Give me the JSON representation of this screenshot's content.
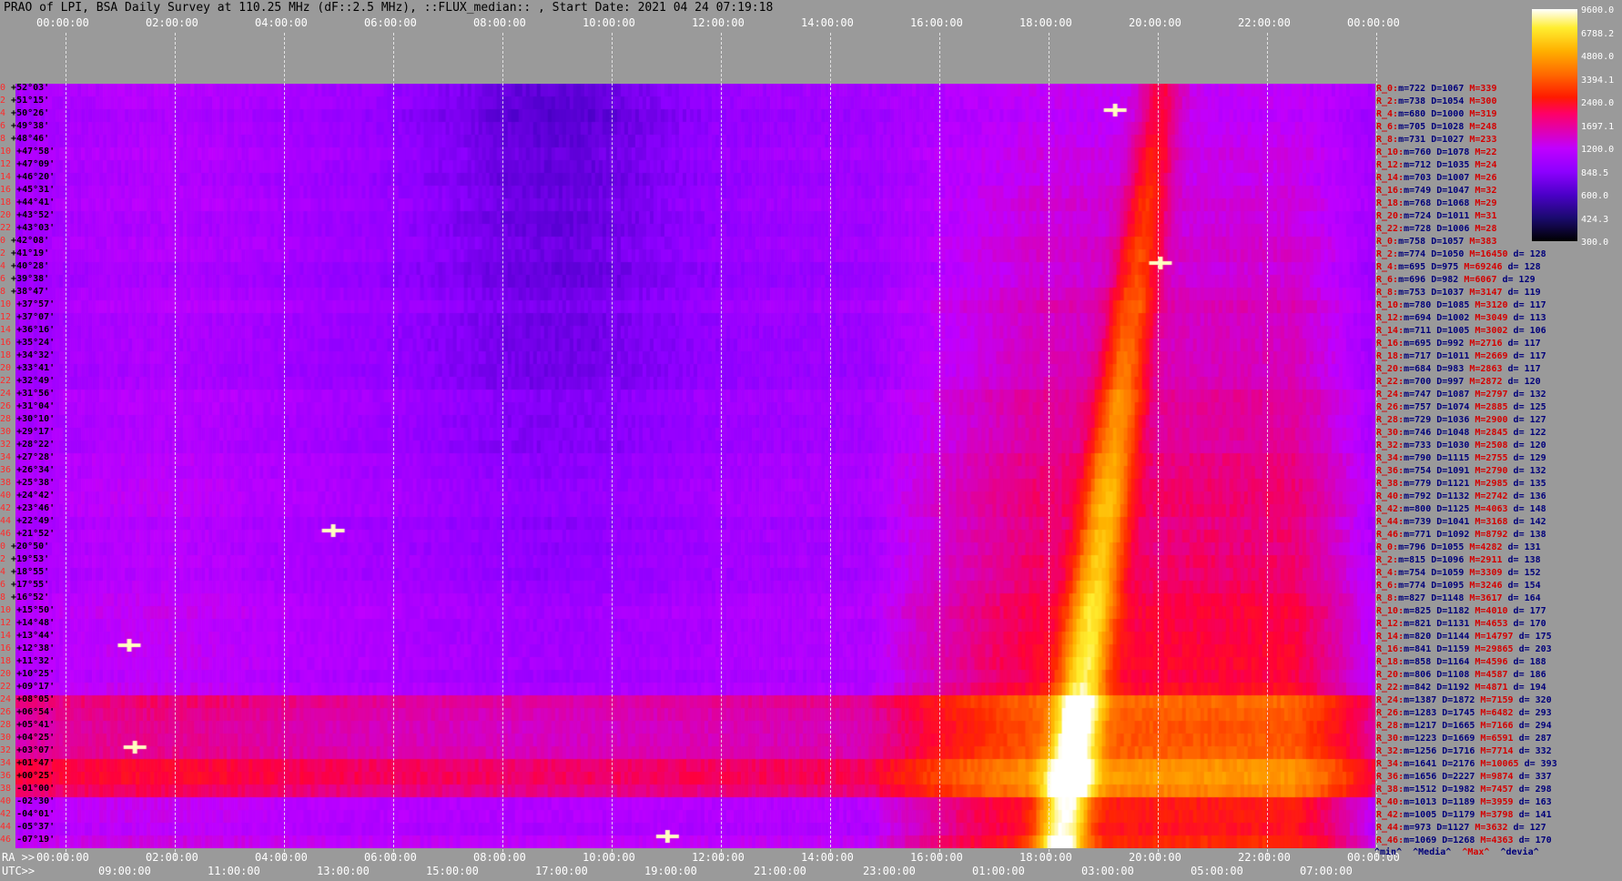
{
  "title": "PRAO of LPI, BSA Daily Survey at 110.25 MHz (dF::2.5 MHz), ::FLUX_median:: , Start Date: 2021 04 24 07:19:18",
  "axes": {
    "top_ticks": [
      "00:00:00",
      "02:00:00",
      "04:00:00",
      "06:00:00",
      "08:00:00",
      "10:00:00",
      "12:00:00",
      "14:00:00",
      "16:00:00",
      "18:00:00",
      "20:00:00",
      "22:00:00",
      "00:00:00"
    ],
    "bottom_ra_label": "RA >>",
    "bottom_ra_ticks": [
      "00:00:00",
      "02:00:00",
      "04:00:00",
      "06:00:00",
      "08:00:00",
      "10:00:00",
      "12:00:00",
      "14:00:00",
      "16:00:00",
      "18:00:00",
      "20:00:00",
      "22:00:00",
      "00:00:00"
    ],
    "utc_label": "UTC>>",
    "utc_ticks": [
      "09:00:00",
      "11:00:00",
      "13:00:00",
      "15:00:00",
      "17:00:00",
      "19:00:00",
      "21:00:00",
      "23:00:00",
      "01:00:00",
      "03:00:00",
      "05:00:00",
      "07:00:00"
    ]
  },
  "colorbar": {
    "labels": [
      "9600.0",
      "6788.2",
      "4800.0",
      "3394.1",
      "2400.0",
      "1697.1",
      "1200.0",
      "848.5",
      "600.0",
      "424.3",
      "300.0"
    ]
  },
  "legend": [
    "^min^",
    "^Media^",
    "^Max^",
    "^devia^"
  ],
  "colors": {
    "background": "#9a9a9a",
    "min_color": "#00007a",
    "max_color": "#d40000"
  },
  "chart_data": {
    "type": "heatmap",
    "title": "PRAO of LPI, BSA Daily Survey at 110.25 MHz (dF::2.5 MHz), ::FLUX_median:: , Start Date: 2021 04 24 07:19:18",
    "x_range_hours": [
      0,
      24
    ],
    "color_scale": "log",
    "color_range": [
      300,
      9600
    ],
    "rows": [
      {
        "idx": "0",
        "dec": "+52°03'",
        "min": "722",
        "median": "1067",
        "max": "339",
        "dev": ""
      },
      {
        "idx": "2",
        "dec": "+51°15'",
        "min": "738",
        "median": "1054",
        "max": "300",
        "dev": ""
      },
      {
        "idx": "4",
        "dec": "+50°26'",
        "min": "680",
        "median": "1000",
        "max": "319",
        "dev": ""
      },
      {
        "idx": "6",
        "dec": "+49°38'",
        "min": "705",
        "median": "1028",
        "max": "248",
        "dev": ""
      },
      {
        "idx": "8",
        "dec": "+48°46'",
        "min": "731",
        "median": "1027",
        "max": "233",
        "dev": ""
      },
      {
        "idx": "10",
        "dec": "+47°58'",
        "min": "760",
        "median": "1078",
        "max": "22",
        "dev": ""
      },
      {
        "idx": "12",
        "dec": "+47°09'",
        "min": "712",
        "median": "1035",
        "max": "24",
        "dev": ""
      },
      {
        "idx": "14",
        "dec": "+46°20'",
        "min": "703",
        "median": "1007",
        "max": "26",
        "dev": ""
      },
      {
        "idx": "16",
        "dec": "+45°31'",
        "min": "749",
        "median": "1047",
        "max": "32",
        "dev": ""
      },
      {
        "idx": "18",
        "dec": "+44°41'",
        "min": "768",
        "median": "1068",
        "max": "29",
        "dev": ""
      },
      {
        "idx": "20",
        "dec": "+43°52'",
        "min": "724",
        "median": "1011",
        "max": "31",
        "dev": ""
      },
      {
        "idx": "22",
        "dec": "+43°03'",
        "min": "728",
        "median": "1006",
        "max": "28",
        "dev": ""
      },
      {
        "idx": "0",
        "dec": "+42°08'",
        "min": "758",
        "median": "1057",
        "max": "383",
        "dev": ""
      },
      {
        "idx": "2",
        "dec": "+41°19'",
        "min": "774",
        "median": "1050",
        "max": "16450",
        "dev": "128"
      },
      {
        "idx": "4",
        "dec": "+40°28'",
        "min": "695",
        "median": "975",
        "max": "69246",
        "dev": "128"
      },
      {
        "idx": "6",
        "dec": "+39°38'",
        "min": "696",
        "median": "982",
        "max": "6067",
        "dev": "129"
      },
      {
        "idx": "8",
        "dec": "+38°47'",
        "min": "753",
        "median": "1037",
        "max": "3147",
        "dev": "119"
      },
      {
        "idx": "10",
        "dec": "+37°57'",
        "min": "780",
        "median": "1085",
        "max": "3120",
        "dev": "117"
      },
      {
        "idx": "12",
        "dec": "+37°07'",
        "min": "694",
        "median": "1002",
        "max": "3049",
        "dev": "113"
      },
      {
        "idx": "14",
        "dec": "+36°16'",
        "min": "711",
        "median": "1005",
        "max": "3002",
        "dev": "106"
      },
      {
        "idx": "16",
        "dec": "+35°24'",
        "min": "695",
        "median": "992",
        "max": "2716",
        "dev": "117"
      },
      {
        "idx": "18",
        "dec": "+34°32'",
        "min": "717",
        "median": "1011",
        "max": "2669",
        "dev": "117"
      },
      {
        "idx": "20",
        "dec": "+33°41'",
        "min": "684",
        "median": "983",
        "max": "2863",
        "dev": "117"
      },
      {
        "idx": "22",
        "dec": "+32°49'",
        "min": "700",
        "median": "997",
        "max": "2872",
        "dev": "120"
      },
      {
        "idx": "24",
        "dec": "+31°56'",
        "min": "747",
        "median": "1087",
        "max": "2797",
        "dev": "132"
      },
      {
        "idx": "26",
        "dec": "+31°04'",
        "min": "757",
        "median": "1074",
        "max": "2885",
        "dev": "125"
      },
      {
        "idx": "28",
        "dec": "+30°10'",
        "min": "729",
        "median": "1036",
        "max": "2900",
        "dev": "127"
      },
      {
        "idx": "30",
        "dec": "+29°17'",
        "min": "746",
        "median": "1048",
        "max": "2845",
        "dev": "122"
      },
      {
        "idx": "32",
        "dec": "+28°22'",
        "min": "733",
        "median": "1030",
        "max": "2508",
        "dev": "120"
      },
      {
        "idx": "34",
        "dec": "+27°28'",
        "min": "790",
        "median": "1115",
        "max": "2755",
        "dev": "129"
      },
      {
        "idx": "36",
        "dec": "+26°34'",
        "min": "754",
        "median": "1091",
        "max": "2790",
        "dev": "132"
      },
      {
        "idx": "38",
        "dec": "+25°38'",
        "min": "779",
        "median": "1121",
        "max": "2985",
        "dev": "135"
      },
      {
        "idx": "40",
        "dec": "+24°42'",
        "min": "792",
        "median": "1132",
        "max": "2742",
        "dev": "136"
      },
      {
        "idx": "42",
        "dec": "+23°46'",
        "min": "800",
        "median": "1125",
        "max": "4063",
        "dev": "148"
      },
      {
        "idx": "44",
        "dec": "+22°49'",
        "min": "739",
        "median": "1041",
        "max": "3168",
        "dev": "142"
      },
      {
        "idx": "46",
        "dec": "+21°52'",
        "min": "771",
        "median": "1092",
        "max": "8792",
        "dev": "138"
      },
      {
        "idx": "0",
        "dec": "+20°50'",
        "min": "796",
        "median": "1055",
        "max": "4282",
        "dev": "131"
      },
      {
        "idx": "2",
        "dec": "+19°53'",
        "min": "815",
        "median": "1096",
        "max": "2911",
        "dev": "138"
      },
      {
        "idx": "4",
        "dec": "+18°55'",
        "min": "754",
        "median": "1059",
        "max": "3309",
        "dev": "152"
      },
      {
        "idx": "6",
        "dec": "+17°55'",
        "min": "774",
        "median": "1095",
        "max": "3246",
        "dev": "154"
      },
      {
        "idx": "8",
        "dec": "+16°52'",
        "min": "827",
        "median": "1148",
        "max": "3617",
        "dev": "164"
      },
      {
        "idx": "10",
        "dec": "+15°50'",
        "min": "825",
        "median": "1182",
        "max": "4010",
        "dev": "177"
      },
      {
        "idx": "12",
        "dec": "+14°48'",
        "min": "821",
        "median": "1131",
        "max": "4653",
        "dev": "170"
      },
      {
        "idx": "14",
        "dec": "+13°44'",
        "min": "820",
        "median": "1144",
        "max": "14797",
        "dev": "175"
      },
      {
        "idx": "16",
        "dec": "+12°38'",
        "min": "841",
        "median": "1159",
        "max": "29865",
        "dev": "203"
      },
      {
        "idx": "18",
        "dec": "+11°32'",
        "min": "858",
        "median": "1164",
        "max": "4596",
        "dev": "188"
      },
      {
        "idx": "20",
        "dec": "+10°25'",
        "min": "806",
        "median": "1108",
        "max": "4587",
        "dev": "186"
      },
      {
        "idx": "22",
        "dec": "+09°17'",
        "min": "842",
        "median": "1192",
        "max": "4871",
        "dev": "194"
      },
      {
        "idx": "24",
        "dec": "+08°05'",
        "min": "1387",
        "median": "1872",
        "max": "7159",
        "dev": "320"
      },
      {
        "idx": "26",
        "dec": "+06°54'",
        "min": "1283",
        "median": "1745",
        "max": "6482",
        "dev": "293"
      },
      {
        "idx": "28",
        "dec": "+05°41'",
        "min": "1217",
        "median": "1665",
        "max": "7166",
        "dev": "294"
      },
      {
        "idx": "30",
        "dec": "+04°25'",
        "min": "1223",
        "median": "1669",
        "max": "6591",
        "dev": "287"
      },
      {
        "idx": "32",
        "dec": "+03°07'",
        "min": "1256",
        "median": "1716",
        "max": "7714",
        "dev": "332"
      },
      {
        "idx": "34",
        "dec": "+01°47'",
        "min": "1641",
        "median": "2176",
        "max": "10065",
        "dev": "393"
      },
      {
        "idx": "36",
        "dec": "+00°25'",
        "min": "1656",
        "median": "2227",
        "max": "9874",
        "dev": "337"
      },
      {
        "idx": "38",
        "dec": "-01°00'",
        "min": "1512",
        "median": "1982",
        "max": "7457",
        "dev": "298"
      },
      {
        "idx": "40",
        "dec": "-02°30'",
        "min": "1013",
        "median": "1189",
        "max": "3959",
        "dev": "163"
      },
      {
        "idx": "42",
        "dec": "-04°01'",
        "min": "1005",
        "median": "1179",
        "max": "3798",
        "dev": "141"
      },
      {
        "idx": "44",
        "dec": "-05°37'",
        "min": "973",
        "median": "1127",
        "max": "3632",
        "dev": "127"
      },
      {
        "idx": "46",
        "dec": "-07°19'",
        "min": "1069",
        "median": "1268",
        "max": "4363",
        "dev": "170"
      }
    ]
  }
}
